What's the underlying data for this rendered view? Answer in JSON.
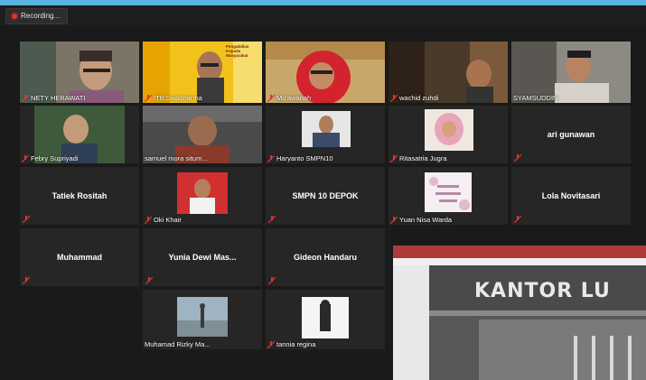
{
  "recording": {
    "label": "Recording..."
  },
  "participants": [
    {
      "name": "NETY HERAWATI",
      "mode": "video"
    },
    {
      "name": "ITB Swadharma",
      "mode": "video",
      "banner": "Pengabdian Kepada Masyarakat"
    },
    {
      "name": "Mu'awanah",
      "mode": "video",
      "active": true
    },
    {
      "name": "wachid zuhdi",
      "mode": "video"
    },
    {
      "name": "SYAMSUDDIN",
      "mode": "video"
    },
    {
      "name": "Febry Supriyadi",
      "mode": "video"
    },
    {
      "name": "samuel mora situm...",
      "mode": "video"
    },
    {
      "name": "Haryanto SMPN10",
      "mode": "photo"
    },
    {
      "name": "Ritasatria Jugra",
      "mode": "photo"
    },
    {
      "name": "ari gunawan",
      "mode": "text"
    },
    {
      "name": "Tatiek Rositah",
      "mode": "text"
    },
    {
      "name": "Oki Khair",
      "mode": "photo"
    },
    {
      "name": "SMPN 10 DEPOK",
      "mode": "text"
    },
    {
      "name": "Yuan Nisa Warda",
      "mode": "photo"
    },
    {
      "name": "Lola Novitasari",
      "mode": "text"
    },
    {
      "name": "Muhammad",
      "mode": "text"
    },
    {
      "name": "Yunia Dewi Mas...",
      "mode": "text"
    },
    {
      "name": "Gideon Handaru",
      "mode": "text"
    },
    {
      "name": "Muhamad Rizky Ma...",
      "mode": "photo"
    },
    {
      "name": "tannia regina",
      "mode": "photo"
    }
  ],
  "share": {
    "sign_text": "KANTOR LU"
  },
  "colors": {
    "accent": "#e6e600",
    "mic_muted": "#d93636",
    "topbar": "#5ab4e0"
  }
}
